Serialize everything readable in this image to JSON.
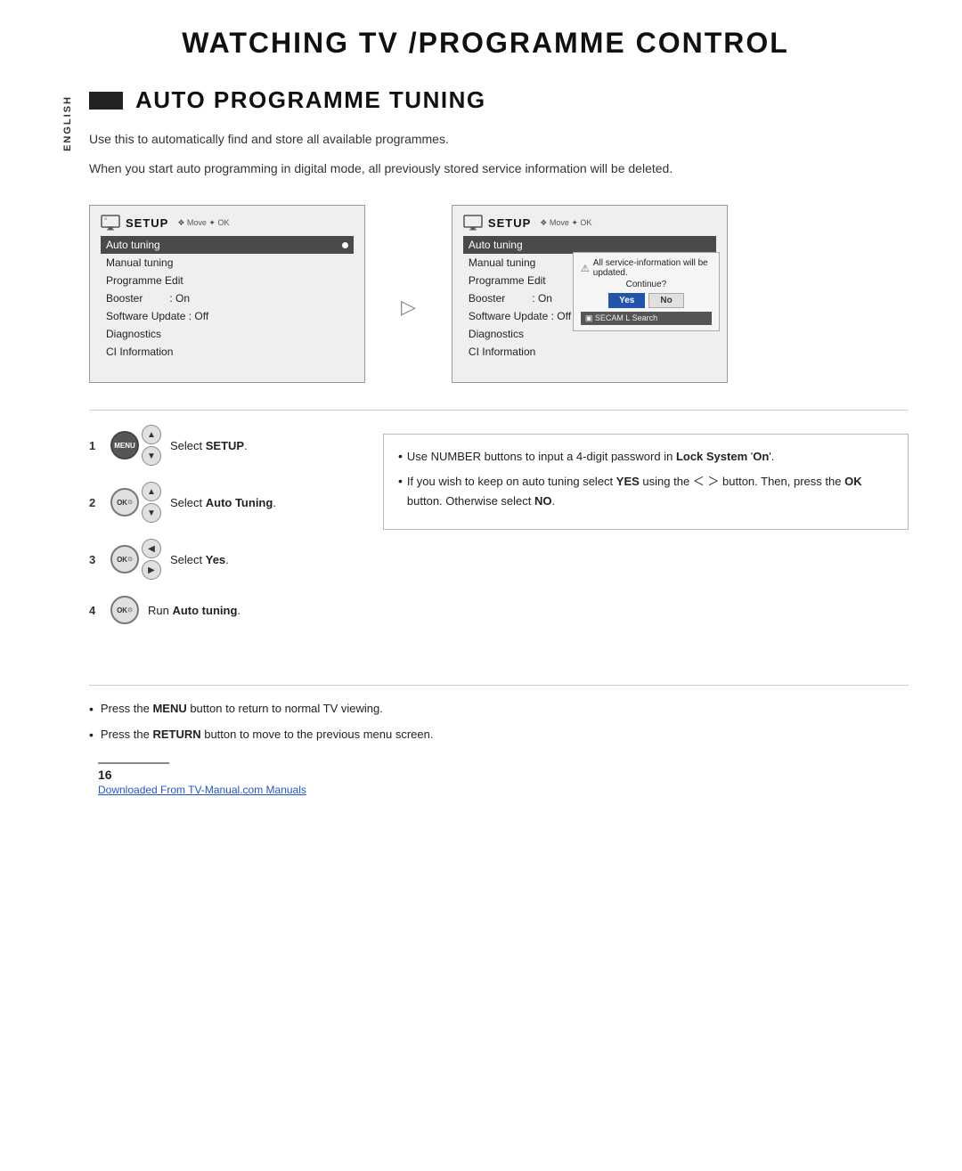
{
  "page": {
    "main_title": "WATCHING TV /PROGRAMME CONTROL",
    "section_label": "ENGLISH",
    "section_heading": "AUTO PROGRAMME TUNING",
    "intro_text": "Use this to automatically find and store all available programmes.",
    "warning_text": "When you start auto programming in digital mode, all previously stored service information will be deleted.",
    "screenshots": {
      "left": {
        "header": "SETUP",
        "nav_hint": "❖ Move  ✦ OK",
        "items": [
          {
            "label": "Auto tuning",
            "selected": true,
            "dot": true
          },
          {
            "label": "Manual tuning",
            "selected": false
          },
          {
            "label": "Programme Edit",
            "selected": false
          },
          {
            "label": "Booster       : On",
            "selected": false
          },
          {
            "label": "Software Update : Off",
            "selected": false
          },
          {
            "label": "Diagnostics",
            "selected": false
          },
          {
            "label": "CI Information",
            "selected": false
          }
        ]
      },
      "right": {
        "header": "SETUP",
        "nav_hint": "❖ Move  ✦ OK",
        "items": [
          {
            "label": "Auto tuning",
            "selected": true
          },
          {
            "label": "Manual tuning",
            "selected": false
          },
          {
            "label": "Programme Edit",
            "selected": false
          },
          {
            "label": "Booster       : On",
            "selected": false
          },
          {
            "label": "Software Update : Off",
            "selected": false
          },
          {
            "label": "Diagnostics",
            "selected": false
          },
          {
            "label": "CI Information",
            "selected": false
          }
        ],
        "dialog": {
          "message": "All service-information will be updated.",
          "question": "Continue?",
          "yes_label": "Yes",
          "no_label": "No",
          "secam_label": "▣ SECAM L Search"
        }
      }
    },
    "steps": [
      {
        "number": "1",
        "buttons": "menu_up_down",
        "description": "Select ",
        "bold": "SETUP",
        "period": "."
      },
      {
        "number": "2",
        "buttons": "ok_up_down",
        "description": "Select ",
        "bold": "Auto Tuning",
        "period": "."
      },
      {
        "number": "3",
        "buttons": "ok_left_right",
        "description": "Select ",
        "bold": "Yes",
        "period": "."
      },
      {
        "number": "4",
        "buttons": "ok_only",
        "description": "Run ",
        "bold": "Auto tuning",
        "period": "."
      }
    ],
    "right_panel": {
      "bullets": [
        "Use NUMBER buttons to input a 4-digit password in Lock System 'On'.",
        "If you wish to keep on auto tuning select YES using the ＜ ＞ button. Then, press the OK button. Otherwise select NO."
      ]
    },
    "bottom_notes": [
      "Press the MENU button to return to normal TV viewing.",
      "Press the RETURN button to move to the previous menu screen."
    ],
    "page_number": "16",
    "page_link": "Downloaded From TV-Manual.com Manuals"
  }
}
